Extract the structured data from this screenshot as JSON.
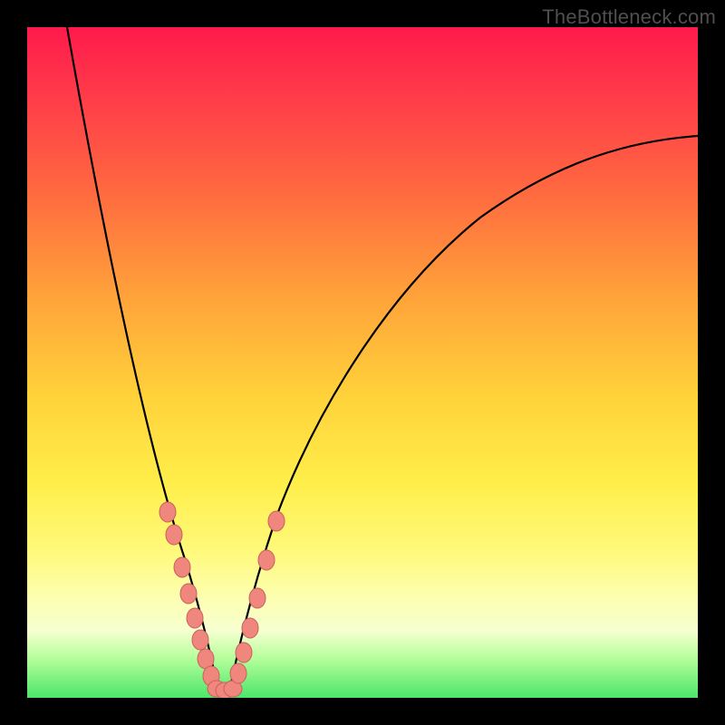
{
  "watermark": {
    "text": "TheBottleneck.com"
  },
  "chart_data": {
    "type": "line",
    "title": "",
    "xlabel": "",
    "ylabel": "",
    "xlim": [
      0,
      100
    ],
    "ylim": [
      0,
      100
    ],
    "legend": false,
    "grid": false,
    "background_gradient": {
      "direction": "vertical",
      "stops": [
        {
          "pos": 0,
          "color": "#ff1a4b"
        },
        {
          "pos": 25,
          "color": "#ff6b3f"
        },
        {
          "pos": 55,
          "color": "#ffd23a"
        },
        {
          "pos": 85,
          "color": "#fdffb0"
        },
        {
          "pos": 100,
          "color": "#4be56a"
        }
      ]
    },
    "series": [
      {
        "name": "left-branch",
        "color": "#000000",
        "x": [
          6,
          8,
          10,
          12,
          14,
          16,
          18,
          20,
          21,
          22,
          23,
          24,
          25,
          26,
          27,
          28
        ],
        "y": [
          100,
          88,
          76,
          65,
          55,
          46,
          37,
          28,
          24,
          20,
          16,
          12,
          8,
          5,
          2,
          0
        ]
      },
      {
        "name": "right-branch",
        "color": "#000000",
        "x": [
          30,
          31,
          32,
          33,
          34,
          36,
          40,
          45,
          50,
          55,
          60,
          65,
          70,
          75,
          80,
          85,
          90,
          95,
          100
        ],
        "y": [
          0,
          3,
          7,
          11,
          15,
          22,
          33,
          44,
          52,
          58,
          63,
          67,
          70,
          73,
          75,
          77,
          78.5,
          80,
          81
        ]
      }
    ],
    "markers": {
      "color": "#f0877f",
      "stroke": "#c0564f",
      "radius_px": 9,
      "points": [
        {
          "branch": "left",
          "x": 20.0,
          "y": 29
        },
        {
          "branch": "left",
          "x": 21.0,
          "y": 25
        },
        {
          "branch": "left",
          "x": 22.2,
          "y": 19
        },
        {
          "branch": "left",
          "x": 23.2,
          "y": 15
        },
        {
          "branch": "left",
          "x": 24.2,
          "y": 11
        },
        {
          "branch": "left",
          "x": 25.2,
          "y": 8
        },
        {
          "branch": "left",
          "x": 26.0,
          "y": 5
        },
        {
          "branch": "left",
          "x": 27.0,
          "y": 2
        },
        {
          "branch": "left",
          "x": 28.0,
          "y": 0.5
        },
        {
          "branch": "right",
          "x": 29.0,
          "y": 0.5
        },
        {
          "branch": "right",
          "x": 30.0,
          "y": 0.5
        },
        {
          "branch": "right",
          "x": 31.0,
          "y": 3
        },
        {
          "branch": "right",
          "x": 32.0,
          "y": 7
        },
        {
          "branch": "right",
          "x": 33.0,
          "y": 11
        },
        {
          "branch": "right",
          "x": 34.0,
          "y": 16
        },
        {
          "branch": "right",
          "x": 35.5,
          "y": 22
        },
        {
          "branch": "right",
          "x": 37.0,
          "y": 27
        }
      ]
    }
  }
}
